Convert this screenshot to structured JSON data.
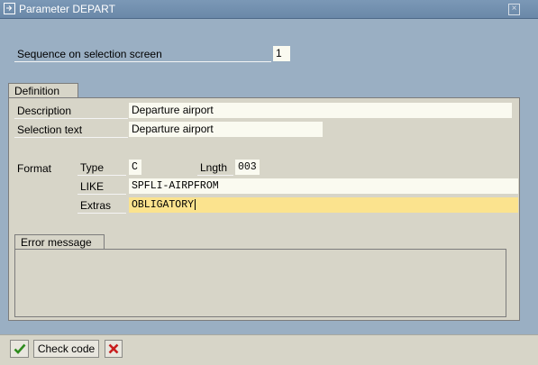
{
  "window": {
    "title": "Parameter DEPART",
    "close_glyph": "×"
  },
  "sequence": {
    "label": "Sequence on selection screen",
    "value": "1"
  },
  "definition": {
    "tab_label": "Definition",
    "description_label": "Description",
    "description_value": "Departure airport",
    "selection_text_label": "Selection text",
    "selection_text_value": "Departure airport",
    "format_label": "Format",
    "type_label": "Type",
    "type_value": "C",
    "length_label": "Lngth",
    "length_value": "003",
    "like_label": "LIKE",
    "like_value": "SPFLI-AIRPFROM",
    "extras_label": "Extras",
    "extras_value": "OBLIGATORY"
  },
  "error_group": {
    "tab_label": "Error message"
  },
  "toolbar": {
    "check_code_label": "Check code"
  },
  "colors": {
    "background": "#9aafc3",
    "group": "#d7d5c8",
    "input": "#fafaf0",
    "focus": "#fbe38e"
  }
}
